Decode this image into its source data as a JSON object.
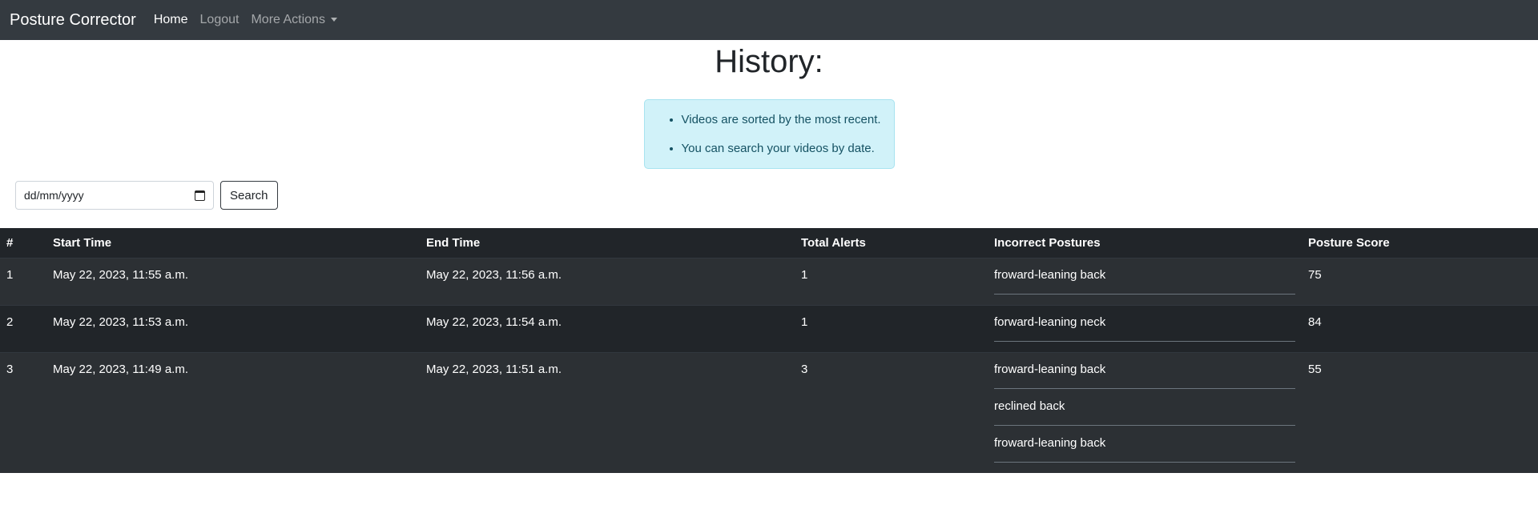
{
  "navbar": {
    "brand": "Posture Corrector",
    "home": "Home",
    "logout": "Logout",
    "more_actions": "More Actions"
  },
  "page": {
    "title": "History:"
  },
  "info": {
    "items": [
      "Videos are sorted by the most recent.",
      "You can search your videos by date."
    ]
  },
  "search": {
    "date_placeholder": "dd/mm/yyyy",
    "button_label": "Search"
  },
  "table": {
    "headers": [
      "#",
      "Start Time",
      "End Time",
      "Total Alerts",
      "Incorrect Postures",
      "Posture Score"
    ],
    "rows": [
      {
        "num": "1",
        "start": "May 22, 2023, 11:55 a.m.",
        "end": "May 22, 2023, 11:56 a.m.",
        "alerts": "1",
        "postures": [
          "froward-leaning back"
        ],
        "score": "75"
      },
      {
        "num": "2",
        "start": "May 22, 2023, 11:53 a.m.",
        "end": "May 22, 2023, 11:54 a.m.",
        "alerts": "1",
        "postures": [
          "forward-leaning neck"
        ],
        "score": "84"
      },
      {
        "num": "3",
        "start": "May 22, 2023, 11:49 a.m.",
        "end": "May 22, 2023, 11:51 a.m.",
        "alerts": "3",
        "postures": [
          "froward-leaning back",
          "reclined back",
          "froward-leaning back"
        ],
        "score": "55"
      }
    ]
  }
}
